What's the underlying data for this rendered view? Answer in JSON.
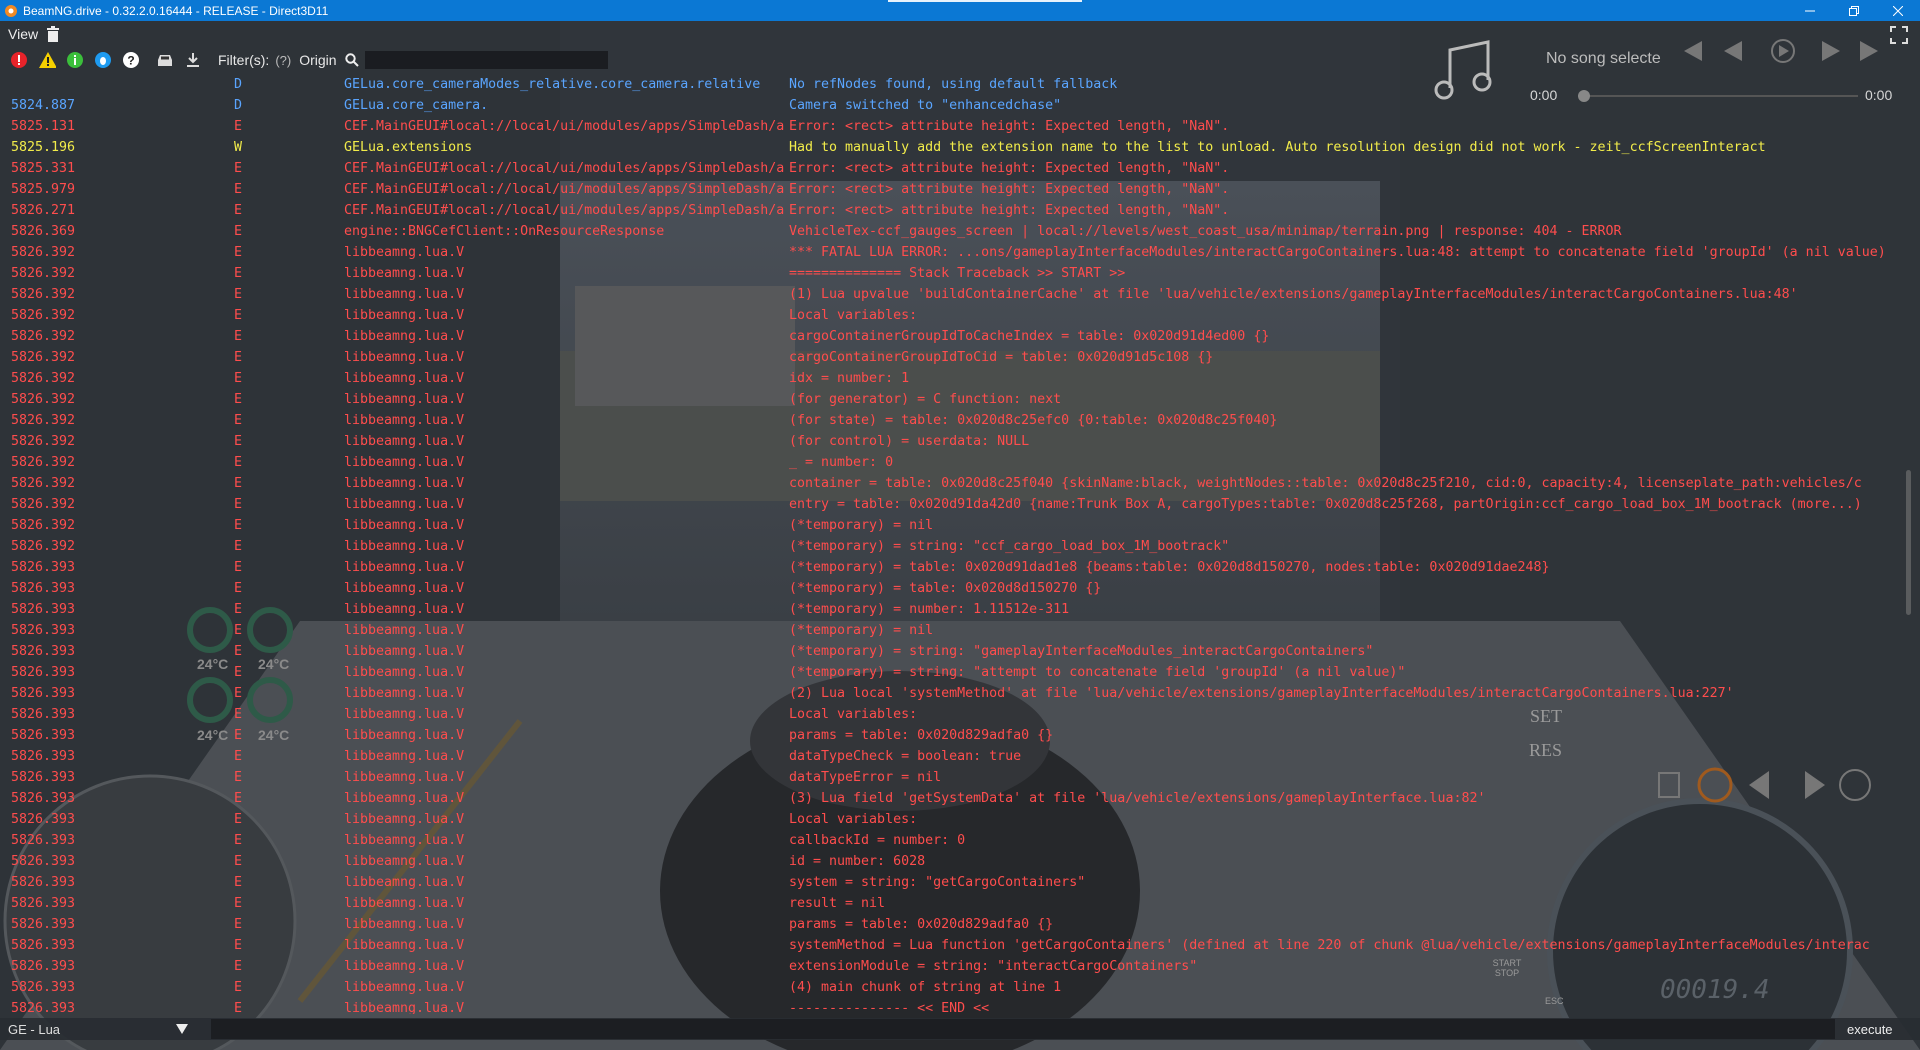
{
  "window": {
    "title": "BeamNG.drive - 0.32.2.0.16444 - RELEASE - Direct3D11",
    "title_bar_color": "#0b78d4",
    "controls": [
      "minimize-icon",
      "restore-icon",
      "close-icon"
    ]
  },
  "menu": {
    "view_label": "View",
    "trash_icon": "trash-icon"
  },
  "toolbar": {
    "icons": [
      "error-filter-icon",
      "warning-filter-icon",
      "info-filter-icon",
      "debug-filter-icon",
      "help-filter-icon",
      "vehicle-icon",
      "download-icon"
    ],
    "filters_label": "Filter(s):",
    "help_hint": "(?)",
    "origin_label": "Origin",
    "search_placeholder": ""
  },
  "music": {
    "song": "No song selecte",
    "time_start": "0:00",
    "time_end": "0:00"
  },
  "hud": {
    "temp_1": "24°C",
    "temp_2": "24°C",
    "temp_3": "24°C",
    "temp_4": "24°C",
    "set": "SET",
    "res": "RES",
    "engine": "START STOP",
    "esc": "ESC",
    "odometer": "00019.4"
  },
  "colors": {
    "debug": "#5aa5ff",
    "error": "#ff4d4d",
    "warning": "#f2ec4a"
  },
  "log": [
    {
      "t": "",
      "l": "D",
      "o": "GELua.core_cameraModes_relative.core_camera.relative",
      "m": "No refNodes found, using default fallback"
    },
    {
      "t": "5824.887",
      "l": "D",
      "o": "GELua.core_camera.",
      "m": "Camera switched to \"enhancedchase\""
    },
    {
      "t": "5825.131",
      "l": "E",
      "o": "CEF.MainGEUI#local://local/ui/modules/apps/SimpleDash/a",
      "m": "Error: <rect> attribute height: Expected length, \"NaN\"."
    },
    {
      "t": "5825.196",
      "l": "W",
      "o": "GELua.extensions",
      "m": "Had to manually add the extension name to the list to unload. Auto resolution design did not work - zeit_ccfScreenInteract"
    },
    {
      "t": "5825.331",
      "l": "E",
      "o": "CEF.MainGEUI#local://local/ui/modules/apps/SimpleDash/a",
      "m": "Error: <rect> attribute height: Expected length, \"NaN\"."
    },
    {
      "t": "5825.979",
      "l": "E",
      "o": "CEF.MainGEUI#local://local/ui/modules/apps/SimpleDash/a",
      "m": "Error: <rect> attribute height: Expected length, \"NaN\"."
    },
    {
      "t": "5826.271",
      "l": "E",
      "o": "CEF.MainGEUI#local://local/ui/modules/apps/SimpleDash/a",
      "m": "Error: <rect> attribute height: Expected length, \"NaN\"."
    },
    {
      "t": "5826.369",
      "l": "E",
      "o": "engine::BNGCefClient::OnResourceResponse",
      "m": "VehicleTex-ccf_gauges_screen | local://levels/west_coast_usa/minimap/terrain.png | response: 404 - ERROR"
    },
    {
      "t": "5826.392",
      "l": "E",
      "o": "libbeamng.lua.V",
      "m": "*** FATAL LUA ERROR: ...ons/gameplayInterfaceModules/interactCargoContainers.lua:48: attempt to concatenate field 'groupId' (a nil value)"
    },
    {
      "t": "5826.392",
      "l": "E",
      "o": "libbeamng.lua.V",
      "m": "============== Stack Traceback >> START >>"
    },
    {
      "t": "5826.392",
      "l": "E",
      "o": "libbeamng.lua.V",
      "m": "(1) Lua upvalue 'buildContainerCache' at file 'lua/vehicle/extensions/gameplayInterfaceModules/interactCargoContainers.lua:48'"
    },
    {
      "t": "5826.392",
      "l": "E",
      "o": "libbeamng.lua.V",
      "m": "  Local variables:"
    },
    {
      "t": "5826.392",
      "l": "E",
      "o": "libbeamng.lua.V",
      "m": "  cargoContainerGroupIdToCacheIndex = table: 0x020d91d4ed00  {}"
    },
    {
      "t": "5826.392",
      "l": "E",
      "o": "libbeamng.lua.V",
      "m": "  cargoContainerGroupIdToCid = table: 0x020d91d5c108  {}"
    },
    {
      "t": "5826.392",
      "l": "E",
      "o": "libbeamng.lua.V",
      "m": "  idx = number: 1"
    },
    {
      "t": "5826.392",
      "l": "E",
      "o": "libbeamng.lua.V",
      "m": "  (for generator) = C function: next"
    },
    {
      "t": "5826.392",
      "l": "E",
      "o": "libbeamng.lua.V",
      "m": "  (for state) = table: 0x020d8c25efc0  {0:table: 0x020d8c25f040}"
    },
    {
      "t": "5826.392",
      "l": "E",
      "o": "libbeamng.lua.V",
      "m": "  (for control) = userdata: NULL"
    },
    {
      "t": "5826.392",
      "l": "E",
      "o": "libbeamng.lua.V",
      "m": "  _ = number: 0"
    },
    {
      "t": "5826.392",
      "l": "E",
      "o": "libbeamng.lua.V",
      "m": "  container = table: 0x020d8c25f040  {skinName:black, weightNodes::table: 0x020d8c25f210, cid:0, capacity:4, licenseplate_path:vehicles/c"
    },
    {
      "t": "5826.392",
      "l": "E",
      "o": "libbeamng.lua.V",
      "m": "  entry = table: 0x020d91da42d0  {name:Trunk Box A, cargoTypes:table: 0x020d8c25f268, partOrigin:ccf_cargo_load_box_1M_bootrack (more...)"
    },
    {
      "t": "5826.392",
      "l": "E",
      "o": "libbeamng.lua.V",
      "m": "  (*temporary) = nil"
    },
    {
      "t": "5826.392",
      "l": "E",
      "o": "libbeamng.lua.V",
      "m": "  (*temporary) = string: \"ccf_cargo_load_box_1M_bootrack\""
    },
    {
      "t": "5826.393",
      "l": "E",
      "o": "libbeamng.lua.V",
      "m": "  (*temporary) = table: 0x020d91dad1e8  {beams:table: 0x020d8d150270, nodes:table: 0x020d91dae248}"
    },
    {
      "t": "5826.393",
      "l": "E",
      "o": "libbeamng.lua.V",
      "m": "  (*temporary) = table: 0x020d8d150270  {}"
    },
    {
      "t": "5826.393",
      "l": "E",
      "o": "libbeamng.lua.V",
      "m": "  (*temporary) = number: 1.11512e-311"
    },
    {
      "t": "5826.393",
      "l": "E",
      "o": "libbeamng.lua.V",
      "m": "  (*temporary) = nil"
    },
    {
      "t": "5826.393",
      "l": "E",
      "o": "libbeamng.lua.V",
      "m": "  (*temporary) = string: \"gameplayInterfaceModules_interactCargoContainers\""
    },
    {
      "t": "5826.393",
      "l": "E",
      "o": "libbeamng.lua.V",
      "m": "  (*temporary) = string: \"attempt to concatenate field 'groupId' (a nil value)\""
    },
    {
      "t": "5826.393",
      "l": "E",
      "o": "libbeamng.lua.V",
      "m": "(2) Lua local 'systemMethod' at file 'lua/vehicle/extensions/gameplayInterfaceModules/interactCargoContainers.lua:227'"
    },
    {
      "t": "5826.393",
      "l": "E",
      "o": "libbeamng.lua.V",
      "m": "  Local variables:"
    },
    {
      "t": "5826.393",
      "l": "E",
      "o": "libbeamng.lua.V",
      "m": "  params = table: 0x020d829adfa0  {}"
    },
    {
      "t": "5826.393",
      "l": "E",
      "o": "libbeamng.lua.V",
      "m": "  dataTypeCheck = boolean: true"
    },
    {
      "t": "5826.393",
      "l": "E",
      "o": "libbeamng.lua.V",
      "m": "  dataTypeError = nil"
    },
    {
      "t": "5826.393",
      "l": "E",
      "o": "libbeamng.lua.V",
      "m": "(3) Lua field 'getSystemData' at file 'lua/vehicle/extensions/gameplayInterface.lua:82'"
    },
    {
      "t": "5826.393",
      "l": "E",
      "o": "libbeamng.lua.V",
      "m": "  Local variables:"
    },
    {
      "t": "5826.393",
      "l": "E",
      "o": "libbeamng.lua.V",
      "m": "  callbackId = number: 0"
    },
    {
      "t": "5826.393",
      "l": "E",
      "o": "libbeamng.lua.V",
      "m": "  id = number: 6028"
    },
    {
      "t": "5826.393",
      "l": "E",
      "o": "libbeamng.lua.V",
      "m": "  system = string: \"getCargoContainers\""
    },
    {
      "t": "5826.393",
      "l": "E",
      "o": "libbeamng.lua.V",
      "m": "  result = nil"
    },
    {
      "t": "5826.393",
      "l": "E",
      "o": "libbeamng.lua.V",
      "m": "  params = table: 0x020d829adfa0  {}"
    },
    {
      "t": "5826.393",
      "l": "E",
      "o": "libbeamng.lua.V",
      "m": "  systemMethod = Lua function 'getCargoContainers' (defined at line 220 of chunk @lua/vehicle/extensions/gameplayInterfaceModules/interac"
    },
    {
      "t": "5826.393",
      "l": "E",
      "o": "libbeamng.lua.V",
      "m": "  extensionModule = string: \"interactCargoContainers\""
    },
    {
      "t": "5826.393",
      "l": "E",
      "o": "libbeamng.lua.V",
      "m": "(4) main chunk of string at line 1"
    },
    {
      "t": "5826.393",
      "l": "E",
      "o": "libbeamng.lua.V",
      "m": "--------------- << END <<"
    }
  ],
  "console": {
    "context": "GE - Lua",
    "command_value": "",
    "execute_label": "execute"
  }
}
